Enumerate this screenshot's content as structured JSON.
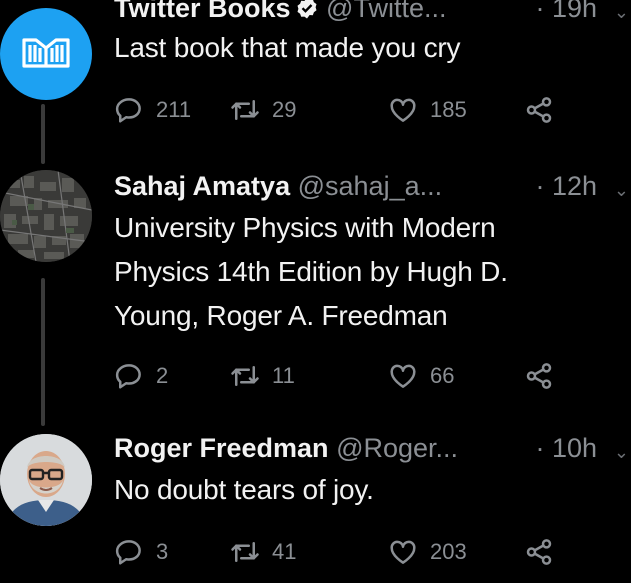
{
  "tweets": [
    {
      "name": "Twitter Books",
      "handle": "@Twitte...",
      "time": "· 19h",
      "text": "Last book that made you cry",
      "replies": "211",
      "retweets": "29",
      "likes": "185",
      "verified": true,
      "avatar_icon": "book-icon"
    },
    {
      "name": "Sahaj Amatya",
      "handle": "@sahaj_a...",
      "time": "· 12h",
      "text": "University Physics with Modern Physics 14th Edition by Hugh D. Young, Roger A. Freedman",
      "replies": "2",
      "retweets": "11",
      "likes": "66"
    },
    {
      "name": "Roger Freedman",
      "handle": "@Roger...",
      "time": "· 10h",
      "text": "No doubt tears of joy.",
      "replies": "3",
      "retweets": "41",
      "likes": "203"
    }
  ],
  "colors": {
    "background": "#000000",
    "text": "#e7e9ea",
    "muted": "#8b8f94",
    "avatar_blue": "#1da1f2",
    "thread_line": "#3a3a3a"
  },
  "icons": {
    "reply": "reply-icon",
    "retweet": "retweet-icon",
    "like": "heart-icon",
    "share": "share-icon",
    "more": "chevron-down-icon",
    "verified": "verified-badge-icon"
  }
}
